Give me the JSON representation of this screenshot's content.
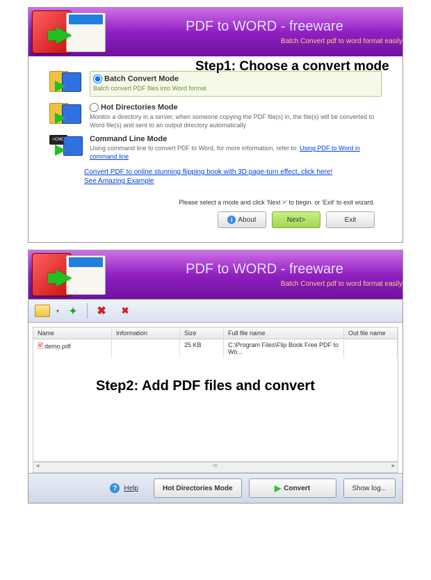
{
  "header": {
    "title": "PDF to WORD - freeware",
    "subtitle": "Batch Convert pdf to word format easily"
  },
  "step1": {
    "overlay": "Step1: Choose a convert mode",
    "modes": [
      {
        "title": "Batch Convert Mode",
        "desc": "Batch convert PDF files into Word format"
      },
      {
        "title": "Hot Directories Mode",
        "desc": "Monitor a directory in a server, when someone copying the PDF file(s) in, the file(s) will be converted to Word file(s) and sent to an output directory automatically"
      },
      {
        "title": "Command Line Mode",
        "desc": "Using command line to convert PDF to Word, for more information, refer to:",
        "link": "Using PDF to Word in command line"
      }
    ],
    "link1": "Convert PDF to online stunning flipping book with 3D page-turn effect, click here!",
    "link2": "See Amazing Example ",
    "prompt": "Please select a mode and click 'Next >' to begin. or 'Exit' to exit wizard.",
    "btn_about": "About",
    "btn_next": "Next>",
    "btn_exit": "Exit"
  },
  "step2": {
    "overlay": "Step2: Add PDF files and convert",
    "columns": {
      "c1": "Name",
      "c2": "Information",
      "c3": "Size",
      "c4": "Full file name",
      "c5": "Out file name"
    },
    "row": {
      "name": "demo.pdf",
      "info": "",
      "size": "25 KB",
      "full": "C:\\Program Files\\Flip Book Free PDF to Wo...",
      "out": ""
    },
    "scroll_mark": "m",
    "btn_help": "Help",
    "btn_hot": "Hot Directories Mode",
    "btn_convert": "Convert",
    "btn_log": "Show log..."
  }
}
